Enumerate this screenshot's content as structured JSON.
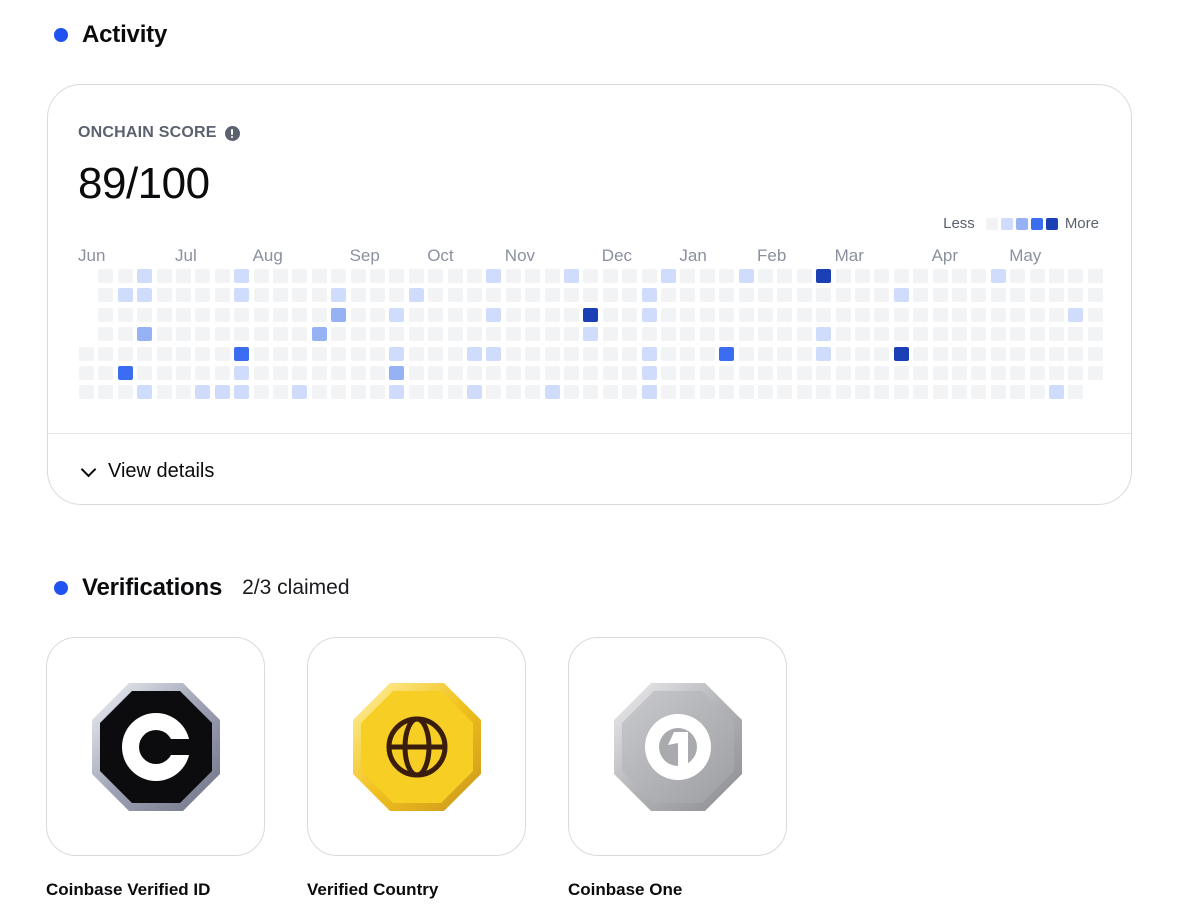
{
  "activity": {
    "title": "Activity",
    "score_label": "ONCHAIN SCORE",
    "score_value": "89/100",
    "legend": {
      "less": "Less",
      "more": "More",
      "colors": [
        "#f2f3f5",
        "#cfdcfb",
        "#96b2f5",
        "#3b6df2",
        "#1b3fb5"
      ]
    },
    "months": [
      "Jun",
      "Jul",
      "Aug",
      "Sep",
      "Oct",
      "Nov",
      "Dec",
      "Jan",
      "Feb",
      "Mar",
      "Apr",
      "May"
    ],
    "month_weeks": [
      0,
      5,
      9,
      14,
      18,
      22,
      27,
      31,
      35,
      39,
      44,
      48
    ],
    "weeks": 53,
    "days": 7,
    "first_week_start_day": 4,
    "last_week_end_day": 5,
    "cells": [
      [
        3,
        0,
        1
      ],
      [
        3,
        1,
        1
      ],
      [
        3,
        3,
        2
      ],
      [
        2,
        1,
        1
      ],
      [
        3,
        6,
        1
      ],
      [
        2,
        5,
        3
      ],
      [
        7,
        6,
        1
      ],
      [
        8,
        0,
        1
      ],
      [
        8,
        1,
        1
      ],
      [
        8,
        4,
        3
      ],
      [
        8,
        5,
        1
      ],
      [
        8,
        6,
        1
      ],
      [
        6,
        6,
        1
      ],
      [
        11,
        6,
        1
      ],
      [
        12,
        3,
        2
      ],
      [
        13,
        1,
        1
      ],
      [
        13,
        2,
        2
      ],
      [
        16,
        2,
        1
      ],
      [
        16,
        4,
        1
      ],
      [
        16,
        5,
        2
      ],
      [
        16,
        6,
        1
      ],
      [
        17,
        1,
        1
      ],
      [
        20,
        4,
        1
      ],
      [
        20,
        6,
        1
      ],
      [
        21,
        0,
        1
      ],
      [
        21,
        2,
        1
      ],
      [
        21,
        4,
        1
      ],
      [
        24,
        6,
        1
      ],
      [
        25,
        0,
        1
      ],
      [
        26,
        2,
        4
      ],
      [
        26,
        3,
        1
      ],
      [
        29,
        1,
        1
      ],
      [
        29,
        2,
        1
      ],
      [
        29,
        4,
        1
      ],
      [
        29,
        5,
        1
      ],
      [
        29,
        6,
        1
      ],
      [
        30,
        0,
        1
      ],
      [
        33,
        4,
        3
      ],
      [
        34,
        0,
        1
      ],
      [
        38,
        0,
        4
      ],
      [
        38,
        3,
        1
      ],
      [
        38,
        4,
        1
      ],
      [
        42,
        1,
        1
      ],
      [
        42,
        4,
        4
      ],
      [
        47,
        0,
        1
      ],
      [
        50,
        6,
        1
      ],
      [
        51,
        2,
        1
      ]
    ],
    "view_details": "View details"
  },
  "verifications": {
    "title": "Verifications",
    "claimed": "2/3 claimed",
    "items": [
      {
        "label": "Coinbase Verified ID",
        "icon": "coinbase-c-badge-icon"
      },
      {
        "label": "Verified Country",
        "icon": "globe-badge-icon"
      },
      {
        "label": "Coinbase One",
        "icon": "coinbase-one-badge-icon"
      }
    ]
  }
}
